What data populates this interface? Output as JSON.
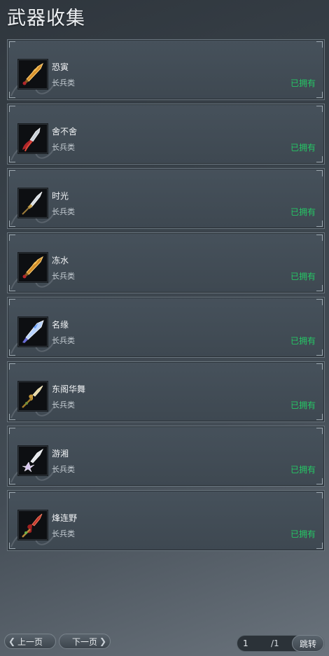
{
  "title": "武器收集",
  "weapons": [
    {
      "name": "恐寅",
      "type": "长兵类",
      "status": "已拥有",
      "icon": "golden-spear-head-icon"
    },
    {
      "name": "舍不舍",
      "type": "长兵类",
      "status": "已拥有",
      "icon": "silver-spear-red-tassel-icon"
    },
    {
      "name": "时光",
      "type": "长兵类",
      "status": "已拥有",
      "icon": "silver-spear-icon"
    },
    {
      "name": "冻水",
      "type": "长兵类",
      "status": "已拥有",
      "icon": "golden-spear-head-icon"
    },
    {
      "name": "名缘",
      "type": "长兵类",
      "status": "已拥有",
      "icon": "blue-crystal-spear-icon"
    },
    {
      "name": "东阁华舞",
      "type": "长兵类",
      "status": "已拥有",
      "icon": "golden-ornate-spear-icon"
    },
    {
      "name": "游湘",
      "type": "长兵类",
      "status": "已拥有",
      "icon": "silver-lotus-spear-icon"
    },
    {
      "name": "烽连野",
      "type": "长兵类",
      "status": "已拥有",
      "icon": "red-flame-spear-icon"
    }
  ],
  "pager": {
    "prev_label": "上一页",
    "next_label": "下一页",
    "current_page": "1",
    "total_label": "/1",
    "jump_label": "跳转"
  },
  "colors": {
    "owned": "#25c765",
    "card_bg": "#434e57",
    "card_border": "#6b7780"
  }
}
